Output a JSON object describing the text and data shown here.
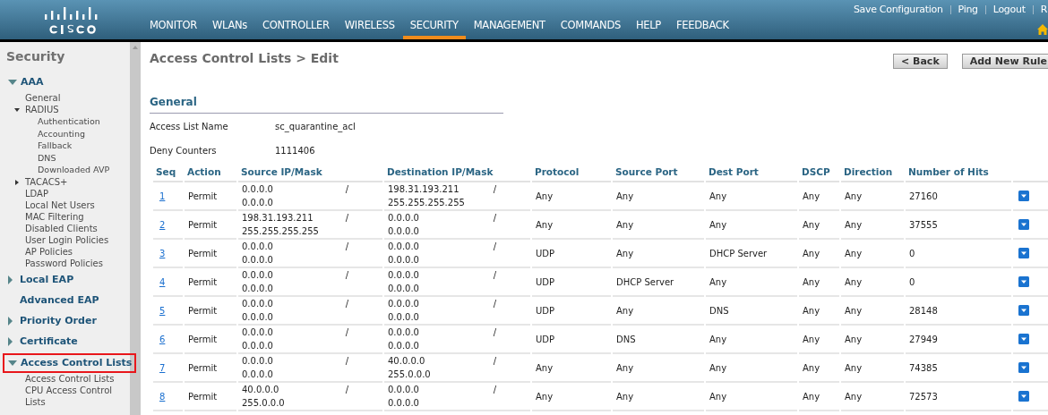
{
  "header": {
    "links": [
      "Save Configuration",
      "Ping",
      "Logout",
      "R"
    ],
    "nav": [
      {
        "label": "MONITOR",
        "selected": false
      },
      {
        "label": "WLANs",
        "selected": false
      },
      {
        "label": "CONTROLLER",
        "selected": false
      },
      {
        "label": "WIRELESS",
        "selected": false
      },
      {
        "label": "SECURITY",
        "selected": true
      },
      {
        "label": "MANAGEMENT",
        "selected": false
      },
      {
        "label": "COMMANDS",
        "selected": false
      },
      {
        "label": "HELP",
        "selected": false
      },
      {
        "label": "FEEDBACK",
        "selected": false
      }
    ]
  },
  "sidebar": {
    "title": "Security",
    "items": [
      {
        "label": "AAA",
        "expanded": true,
        "selected": false,
        "children": [
          {
            "label": "General"
          },
          {
            "label": "RADIUS",
            "expanded": true,
            "children": [
              {
                "label": "Authentication"
              },
              {
                "label": "Accounting"
              },
              {
                "label": "Fallback"
              },
              {
                "label": "DNS"
              },
              {
                "label": "Downloaded AVP"
              }
            ]
          },
          {
            "label": "TACACS+",
            "expanded": false
          },
          {
            "label": "LDAP"
          },
          {
            "label": "Local Net Users"
          },
          {
            "label": "MAC Filtering"
          },
          {
            "label": "Disabled Clients"
          },
          {
            "label": "User Login Policies"
          },
          {
            "label": "AP Policies"
          },
          {
            "label": "Password Policies"
          }
        ]
      },
      {
        "label": "Local EAP",
        "expanded": false,
        "selected": false
      },
      {
        "label": "Advanced EAP",
        "selected": false
      },
      {
        "label": "Priority Order",
        "expanded": false,
        "selected": false
      },
      {
        "label": "Certificate",
        "expanded": false,
        "selected": false
      },
      {
        "label": "Access Control Lists",
        "expanded": true,
        "selected": true,
        "children": [
          {
            "label": "Access Control Lists"
          },
          {
            "label": "CPU Access Control Lists"
          }
        ]
      }
    ]
  },
  "page": {
    "title": "Access Control Lists > Edit",
    "buttons": [
      "< Back",
      "Add New Rule"
    ],
    "section": "General",
    "fields": [
      {
        "label": "Access List Name",
        "value": "sc_quarantine_acl"
      },
      {
        "label": "Deny Counters",
        "value": "1111406"
      }
    ]
  },
  "table": {
    "columns": [
      "Seq",
      "Action",
      "Source IP/Mask",
      "Destination IP/Mask",
      "Protocol",
      "Source Port",
      "Dest Port",
      "DSCP",
      "Direction",
      "Number of Hits"
    ],
    "rows": [
      {
        "seq": "1",
        "action": "Permit",
        "src_ip": "0.0.0.0",
        "src_mask": "0.0.0.0",
        "src_sep": "/",
        "dst_ip": "198.31.193.211",
        "dst_mask": "255.255.255.255",
        "dst_sep": "/",
        "protocol": "Any",
        "src_port": "Any",
        "dst_port": "Any",
        "dscp": "Any",
        "direction": "Any",
        "hits": "27160"
      },
      {
        "seq": "2",
        "action": "Permit",
        "src_ip": "198.31.193.211",
        "src_mask": "255.255.255.255",
        "src_sep": "/",
        "dst_ip": "0.0.0.0",
        "dst_mask": "0.0.0.0",
        "dst_sep": "/",
        "protocol": "Any",
        "src_port": "Any",
        "dst_port": "Any",
        "dscp": "Any",
        "direction": "Any",
        "hits": "37555"
      },
      {
        "seq": "3",
        "action": "Permit",
        "src_ip": "0.0.0.0",
        "src_mask": "0.0.0.0",
        "src_sep": "/",
        "dst_ip": "0.0.0.0",
        "dst_mask": "0.0.0.0",
        "dst_sep": "/",
        "protocol": "UDP",
        "src_port": "Any",
        "dst_port": "DHCP Server",
        "dscp": "Any",
        "direction": "Any",
        "hits": "0"
      },
      {
        "seq": "4",
        "action": "Permit",
        "src_ip": "0.0.0.0",
        "src_mask": "0.0.0.0",
        "src_sep": "/",
        "dst_ip": "0.0.0.0",
        "dst_mask": "0.0.0.0",
        "dst_sep": "/",
        "protocol": "UDP",
        "src_port": "DHCP Server",
        "dst_port": "Any",
        "dscp": "Any",
        "direction": "Any",
        "hits": "0"
      },
      {
        "seq": "5",
        "action": "Permit",
        "src_ip": "0.0.0.0",
        "src_mask": "0.0.0.0",
        "src_sep": "/",
        "dst_ip": "0.0.0.0",
        "dst_mask": "0.0.0.0",
        "dst_sep": "/",
        "protocol": "UDP",
        "src_port": "Any",
        "dst_port": "DNS",
        "dscp": "Any",
        "direction": "Any",
        "hits": "28148"
      },
      {
        "seq": "6",
        "action": "Permit",
        "src_ip": "0.0.0.0",
        "src_mask": "0.0.0.0",
        "src_sep": "/",
        "dst_ip": "0.0.0.0",
        "dst_mask": "0.0.0.0",
        "dst_sep": "/",
        "protocol": "UDP",
        "src_port": "DNS",
        "dst_port": "Any",
        "dscp": "Any",
        "direction": "Any",
        "hits": "27949"
      },
      {
        "seq": "7",
        "action": "Permit",
        "src_ip": "0.0.0.0",
        "src_mask": "0.0.0.0",
        "src_sep": "/",
        "dst_ip": "40.0.0.0",
        "dst_mask": "255.0.0.0",
        "dst_sep": "/",
        "protocol": "Any",
        "src_port": "Any",
        "dst_port": "Any",
        "dscp": "Any",
        "direction": "Any",
        "hits": "74385"
      },
      {
        "seq": "8",
        "action": "Permit",
        "src_ip": "40.0.0.0",
        "src_mask": "255.0.0.0",
        "src_sep": "/",
        "dst_ip": "0.0.0.0",
        "dst_mask": "0.0.0.0",
        "dst_sep": "/",
        "protocol": "Any",
        "src_port": "Any",
        "dst_port": "Any",
        "dscp": "Any",
        "direction": "Any",
        "hits": "72573"
      }
    ]
  }
}
